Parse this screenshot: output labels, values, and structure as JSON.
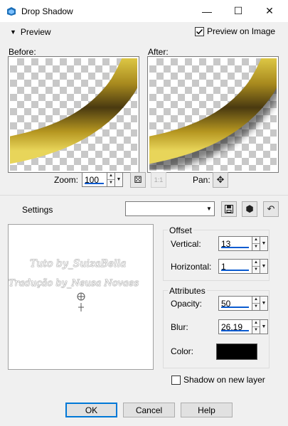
{
  "window": {
    "title": "Drop Shadow",
    "minimize": "—",
    "maximize": "☐",
    "close": "✕"
  },
  "top": {
    "preview_toggle": "Preview",
    "preview_on_image": "Preview on Image",
    "preview_on_image_checked": true
  },
  "previews": {
    "before_label": "Before:",
    "after_label": "After:"
  },
  "zoom": {
    "label": "Zoom:",
    "value": "100",
    "pan_label": "Pan:"
  },
  "settings": {
    "label": "Settings",
    "value": ""
  },
  "offset": {
    "title": "Offset",
    "vertical_label": "Vertical:",
    "vertical_value": "13",
    "horizontal_label": "Horizontal:",
    "horizontal_value": "1"
  },
  "attributes": {
    "title": "Attributes",
    "opacity_label": "Opacity:",
    "opacity_value": "50",
    "blur_label": "Blur:",
    "blur_value": "26,19",
    "color_label": "Color:",
    "color_hex": "#000000"
  },
  "shadow_new_layer": {
    "label": "Shadow on new layer",
    "checked": false
  },
  "watermark": {
    "line1": "Tuto by_SuizaBella",
    "line2": "Tradução by_Neusa Novaes"
  },
  "buttons": {
    "ok": "OK",
    "cancel": "Cancel",
    "help": "Help"
  },
  "colors": {
    "accent": "#0078d7",
    "shadow": "#000000",
    "stroke_dark": "#6b5200",
    "stroke_light": "#e4cf4a"
  }
}
